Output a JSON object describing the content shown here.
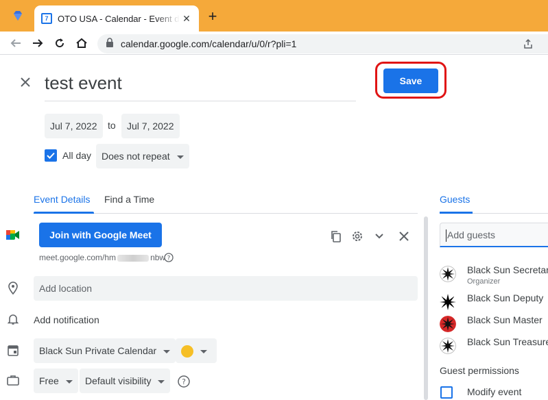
{
  "browser": {
    "tab_title": "OTO USA - Calendar - Event details",
    "favicon_text": "7",
    "url": "calendar.google.com/calendar/u/0/r?pli=1",
    "tabbar_color": "#f5a93a"
  },
  "event": {
    "title": "test event",
    "save_label": "Save",
    "start_date": "Jul 7, 2022",
    "to_label": "to",
    "end_date": "Jul 7, 2022",
    "all_day_label": "All day",
    "all_day_checked": true,
    "repeat": "Does not repeat"
  },
  "tabs": {
    "event_details": "Event Details",
    "find_time": "Find a Time",
    "guests": "Guests"
  },
  "details": {
    "meet_button": "Join with Google Meet",
    "meet_link_start": "meet.google.com/hm",
    "meet_link_end": "nbw",
    "location_placeholder": "Add location",
    "add_notification": "Add notification",
    "calendar": "Black Sun Private Calendar",
    "calendar_color": "#f6bf26",
    "availability": "Free",
    "visibility": "Default visibility"
  },
  "guests": {
    "input_placeholder": "Add guests",
    "list": [
      {
        "name": "Black Sun Secretary",
        "role": "Organizer",
        "avatar": "sun-white"
      },
      {
        "name": "Black Sun Deputy",
        "role": "",
        "avatar": "sun-black"
      },
      {
        "name": "Black Sun Master",
        "role": "",
        "avatar": "sun-red"
      },
      {
        "name": "Black Sun Treasurer",
        "role": "",
        "avatar": "sun-white"
      }
    ],
    "permissions_title": "Guest permissions",
    "permission_modify": "Modify event"
  },
  "colors": {
    "accent": "#1a73e8",
    "highlight_ring": "#e01414"
  }
}
